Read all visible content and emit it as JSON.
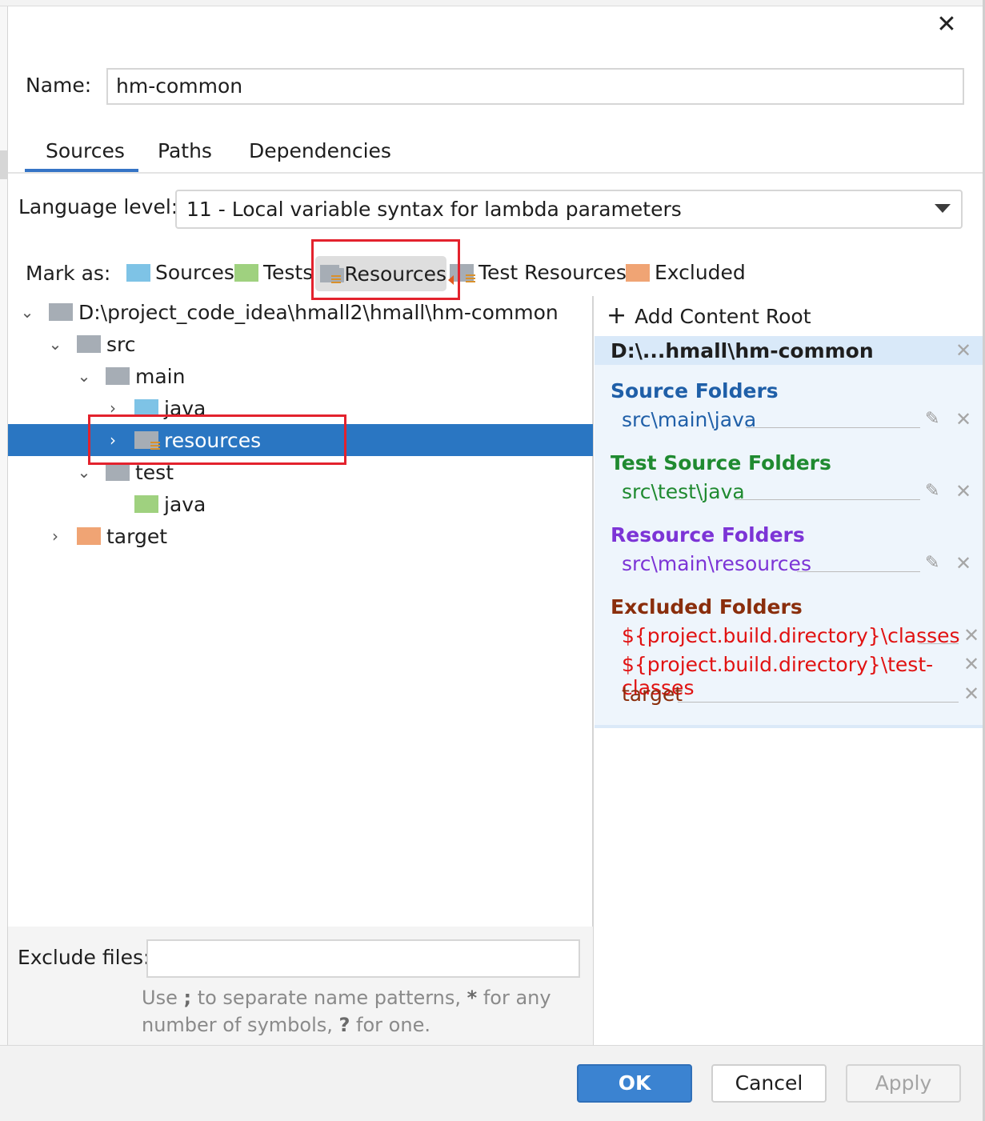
{
  "window": {
    "close_icon": "close-icon"
  },
  "name": {
    "label": "Name:",
    "value": "hm-common"
  },
  "tabs": [
    {
      "label": "Sources",
      "selected": true
    },
    {
      "label": "Paths",
      "selected": false
    },
    {
      "label": "Dependencies",
      "selected": false
    }
  ],
  "language_level": {
    "label": "Language level:",
    "value": "11 - Local variable syntax for lambda parameters"
  },
  "mark_as": {
    "label": "Mark as:",
    "items": [
      {
        "label": "Sources",
        "icon": "folder-blue-icon",
        "color": "#7ec3e6"
      },
      {
        "label": "Tests",
        "icon": "folder-green-icon",
        "color": "#9fd17f"
      },
      {
        "label": "Resources",
        "icon": "folder-resources-icon",
        "color": "#a6adb5",
        "highlighted": true
      },
      {
        "label": "Test Resources",
        "icon": "folder-test-resources-icon",
        "color": "#a6adb5"
      },
      {
        "label": "Excluded",
        "icon": "folder-orange-icon",
        "color": "#f0a474"
      }
    ]
  },
  "tree": {
    "root": "D:\\project_code_idea\\hmall2\\hmall\\hm-common",
    "src": "src",
    "main": "main",
    "main_java": "java",
    "resources": "resources",
    "test": "test",
    "test_java": "java",
    "target": "target",
    "selected": "resources"
  },
  "content_root": {
    "add_label": "Add Content Root",
    "path": "D:\\...hmall\\hm-common",
    "source_folders": {
      "title": "Source Folders",
      "entries": [
        "src\\main\\java"
      ],
      "color": "#1f5fa8"
    },
    "test_source_folders": {
      "title": "Test Source Folders",
      "entries": [
        "src\\test\\java"
      ],
      "color": "#1f8a30"
    },
    "resource_folders": {
      "title": "Resource Folders",
      "entries": [
        "src\\main\\resources"
      ],
      "color": "#7c34d6"
    },
    "excluded_folders": {
      "title": "Excluded Folders",
      "entries": [
        "${project.build.directory}\\classes",
        "${project.build.directory}\\test-classes",
        "target"
      ],
      "title_color": "#8a2e0c",
      "entry_color": "#e11212"
    }
  },
  "exclude_files": {
    "label": "Exclude files:",
    "value": "",
    "hint_a": "Use ",
    "hint_b": ";",
    "hint_c": " to separate name patterns, ",
    "hint_d": "*",
    "hint_e": " for any number of symbols, ",
    "hint_f": "?",
    "hint_g": " for one."
  },
  "buttons": {
    "ok": "OK",
    "cancel": "Cancel",
    "apply": "Apply"
  }
}
